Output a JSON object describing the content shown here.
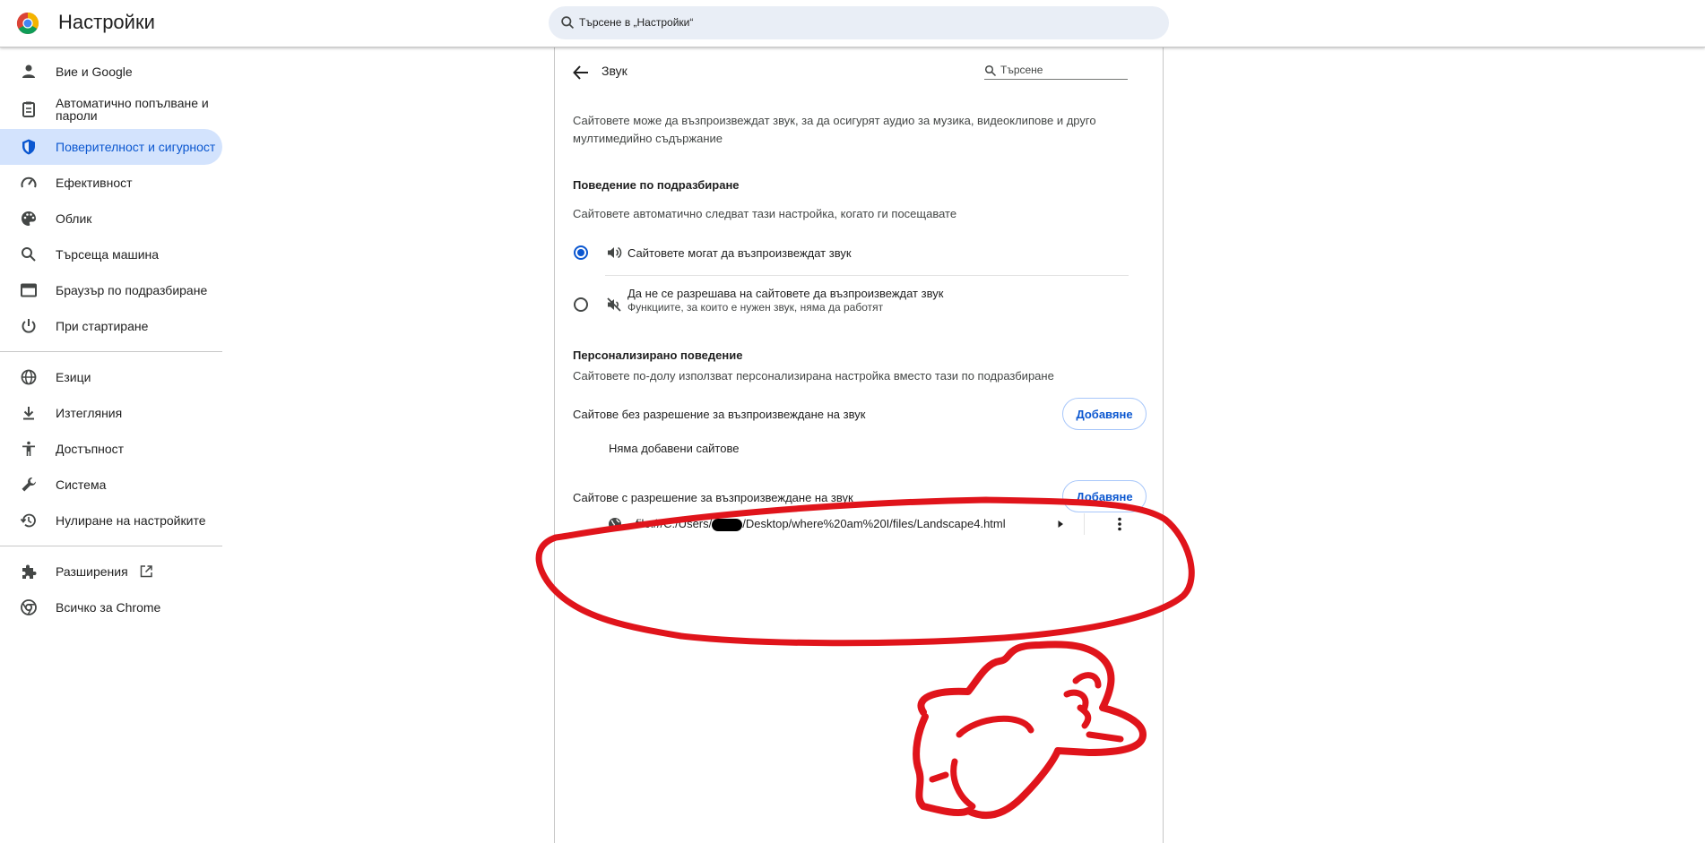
{
  "header": {
    "app_title": "Настройки",
    "search_placeholder": "Търсене в „Настройки“"
  },
  "sidebar": {
    "items": [
      {
        "label": "Вие и Google",
        "icon": "person-icon"
      },
      {
        "label": "Автоматично попълване и пароли",
        "icon": "clipboard-icon"
      },
      {
        "label": "Поверителност и сигурност",
        "icon": "shield-icon",
        "active": true
      },
      {
        "label": "Ефективност",
        "icon": "speedometer-icon"
      },
      {
        "label": "Облик",
        "icon": "palette-icon"
      },
      {
        "label": "Търсеща машина",
        "icon": "search-icon"
      },
      {
        "label": "Браузър по подразбиране",
        "icon": "browser-window-icon"
      },
      {
        "label": "При стартиране",
        "icon": "power-icon"
      },
      {
        "label": "Езици",
        "icon": "globe-icon"
      },
      {
        "label": "Изтегляния",
        "icon": "download-icon"
      },
      {
        "label": "Достъпност",
        "icon": "accessibility-icon"
      },
      {
        "label": "Система",
        "icon": "wrench-icon"
      },
      {
        "label": "Нулиране на настройките",
        "icon": "history-icon"
      },
      {
        "label": "Разширения",
        "icon": "puzzle-icon"
      },
      {
        "label": "Всичко за Chrome",
        "icon": "chrome-icon"
      }
    ]
  },
  "main": {
    "title": "Звук",
    "search_placeholder": "Търсене",
    "description": "Сайтовете може да възпроизвеждат звук, за да осигурят аудио за музика, видеоклипове и друго мултимедийно съдържание",
    "default_behavior": {
      "heading": "Поведение по подразбиране",
      "subtitle": "Сайтовете автоматично следват тази настройка, когато ги посещавате",
      "options": [
        {
          "label": "Сайтовете могат да възпроизвеждат звук",
          "selected": true,
          "icon": "volume-up-icon"
        },
        {
          "label": "Да не се разрешава на сайтовете да възпроизвеждат звук",
          "sublabel": "Функциите, за които е нужен звук, няма да работят",
          "selected": false,
          "icon": "volume-off-icon"
        }
      ]
    },
    "custom_behavior": {
      "heading": "Персонализирано поведение",
      "subtitle": "Сайтовете по-долу използват персонализирана настройка вместо тази по подразбиране",
      "blocked": {
        "label": "Сайтове без разрешение за възпроизвеждане на звук",
        "add_label": "Добавяне",
        "empty_label": "Няма добавени сайтове"
      },
      "allowed": {
        "label": "Сайтове с разрешение за възпроизвеждане на звук",
        "add_label": "Добавяне",
        "site_url": "file:///C:/Users/",
        "site_url_rest": "/Desktop/where%20am%20I/files/Landscape4.html"
      }
    }
  },
  "colors": {
    "accent": "#0b57d0",
    "active_bg": "#d3e3fd",
    "annotation": "#e0141b"
  }
}
